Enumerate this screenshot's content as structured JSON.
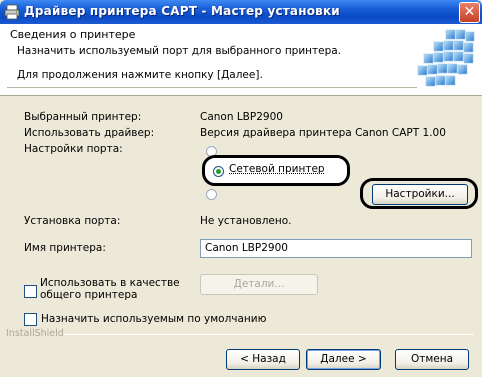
{
  "window": {
    "title": "Драйвер принтера CAPT - Мастер установки",
    "close_label": "✕"
  },
  "header": {
    "title": "Сведения о принтере",
    "subtitle": "Назначить используемый порт для выбранного принтера.",
    "hint": "Для продолжения нажмите кнопку [Далее]."
  },
  "form": {
    "selected_printer_label": "Выбранный принтер:",
    "selected_printer_value": "Canon LBP2900",
    "driver_label": "Использовать драйвер:",
    "driver_value": "Версия драйвера принтера Canon CAPT 1.00",
    "port_settings_label": "Настройки порта:",
    "port_option_network": "Сетевой принтер",
    "settings_button": "Настройки...",
    "port_install_label": "Установка порта:",
    "port_install_value": "Не установлено.",
    "printer_name_label": "Имя принтера:",
    "printer_name_value": "Canon LBP2900",
    "share_checkbox_label_line1": "Использовать в качестве",
    "share_checkbox_label_line2": "общего принтера",
    "share_checked": false,
    "details_button": "Детали...",
    "default_checkbox_label": "Назначить используемым по умолчанию",
    "default_checked": false
  },
  "footer": {
    "brand": "InstallShield",
    "back_button": "< Назад",
    "next_button": "Далее >",
    "cancel_button": "Отмена"
  }
}
